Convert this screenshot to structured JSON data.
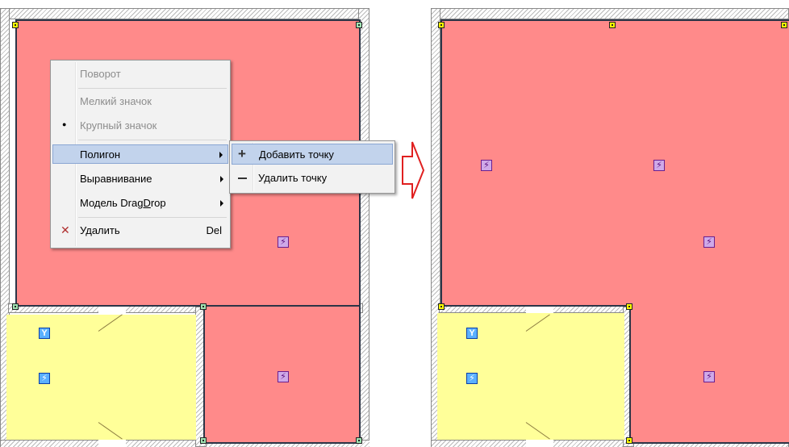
{
  "context_menu": {
    "items": [
      {
        "label": "Поворот",
        "enabled": false
      },
      {
        "label": "Мелкий значок",
        "enabled": false
      },
      {
        "label": "Крупный значок",
        "enabled": false,
        "bullet": true
      },
      {
        "label": "Полигон",
        "submenu": true,
        "highlighted": true
      },
      {
        "label": "Выравнивание",
        "submenu": true
      },
      {
        "label_prefix": "Модель Drag",
        "label_underlined": "D",
        "label_suffix": "rop",
        "submenu": true
      },
      {
        "label": "Удалить",
        "shortcut": "Del",
        "icon": "delete-x-icon"
      }
    ]
  },
  "submenu": {
    "items": [
      {
        "label": "Добавить точку",
        "icon": "plus-icon",
        "highlighted": true
      },
      {
        "label": "Удалить точку",
        "icon": "minus-icon"
      }
    ]
  },
  "icons": {
    "lightning": "⚡",
    "socket": "Y",
    "plus": "+",
    "minus": "—",
    "delete": "✕",
    "bullet": "●"
  },
  "colors": {
    "room_red": "#ff8a8a",
    "room_yellow": "#ffff99",
    "handle_green": "#9fe2b2",
    "handle_yellow": "#ffff00",
    "menu_highlight": "#c2d3ec",
    "arrow": "#e02020"
  }
}
